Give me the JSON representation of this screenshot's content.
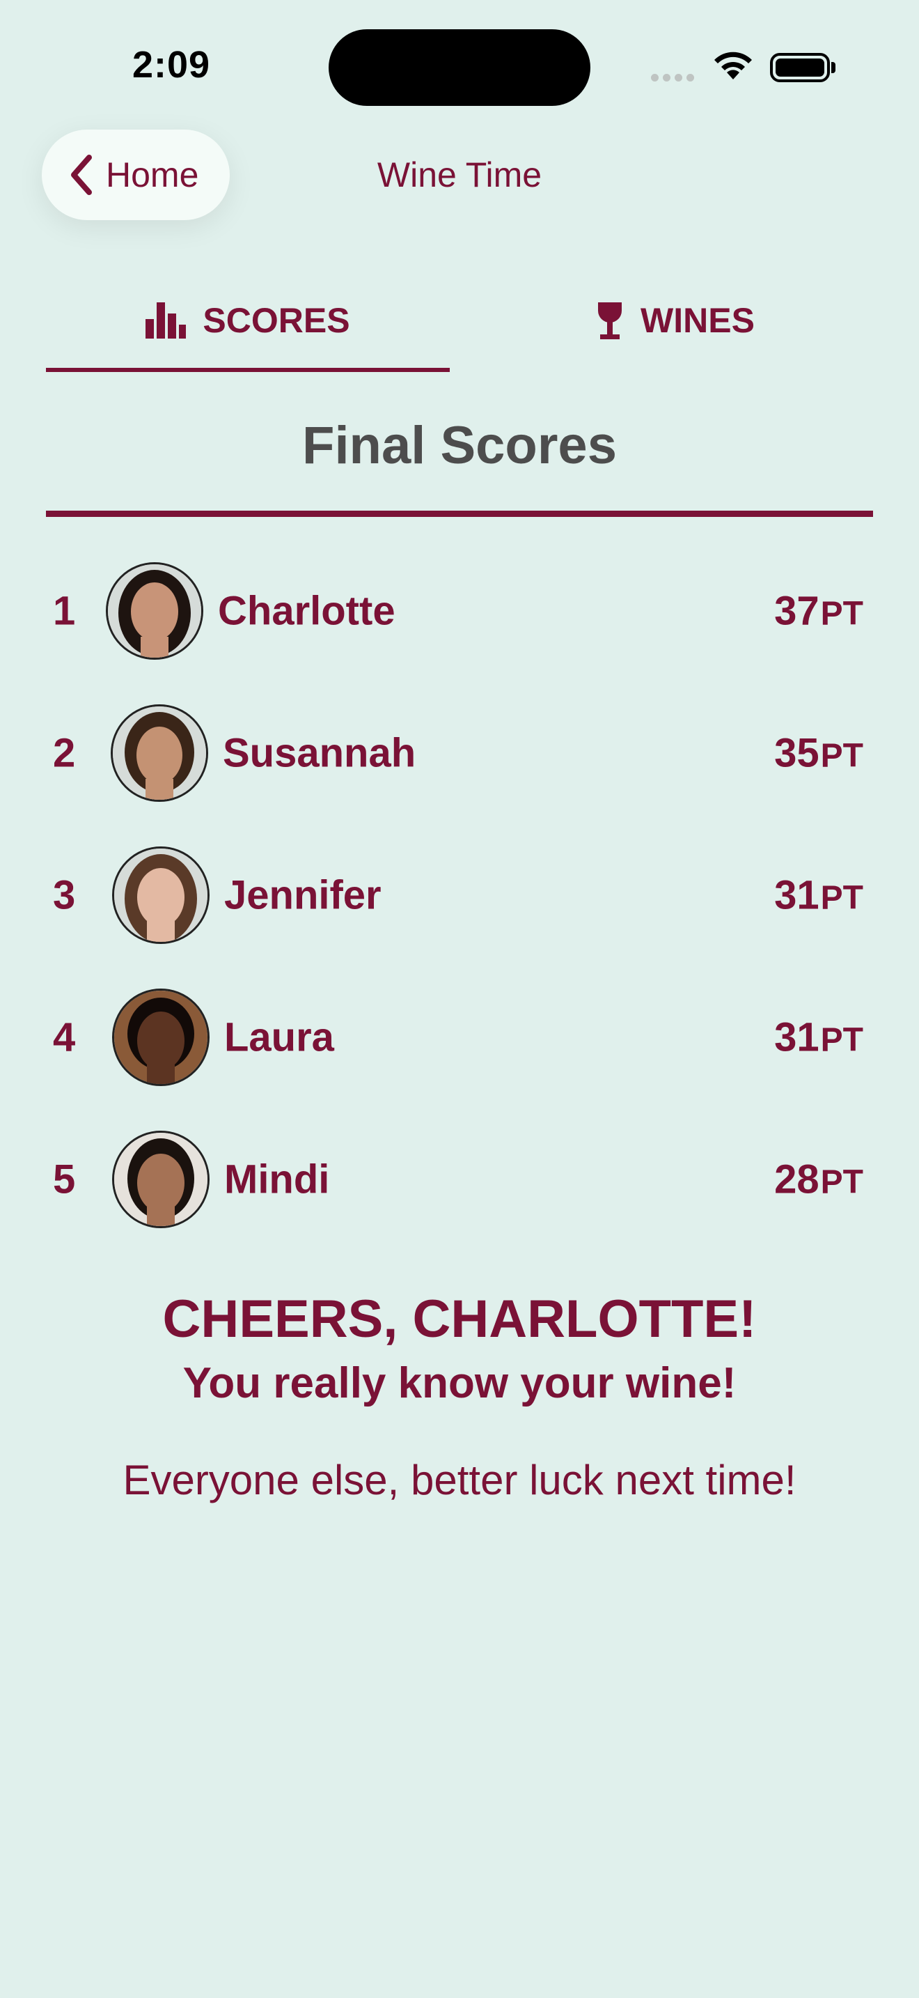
{
  "status_bar": {
    "time": "2:09"
  },
  "nav": {
    "back_label": "Home",
    "title": "Wine Time"
  },
  "tabs": [
    {
      "label": "SCORES",
      "icon": "bar-chart-icon",
      "selected": true
    },
    {
      "label": "WINES",
      "icon": "wine-glass-icon",
      "selected": false
    }
  ],
  "section_title": "Final Scores",
  "scores": [
    {
      "rank": "1",
      "name": "Charlotte",
      "points": "37",
      "unit": "PT",
      "avatar_skin": "#c89478",
      "avatar_hair": "#1e1410"
    },
    {
      "rank": "2",
      "name": "Susannah",
      "points": "35",
      "unit": "PT",
      "avatar_skin": "#c49273",
      "avatar_hair": "#3a2518"
    },
    {
      "rank": "3",
      "name": "Jennifer",
      "points": "31",
      "unit": "PT",
      "avatar_skin": "#e3b9a3",
      "avatar_hair": "#5a3a28"
    },
    {
      "rank": "4",
      "name": "Laura",
      "points": "31",
      "unit": "PT",
      "avatar_skin": "#5c3422",
      "avatar_hair": "#120a08"
    },
    {
      "rank": "5",
      "name": "Mindi",
      "points": "28",
      "unit": "PT",
      "avatar_skin": "#a57255",
      "avatar_hair": "#1a120e"
    }
  ],
  "message": {
    "cheers": "CHEERS, CHARLOTTE!",
    "subtitle": "You really know your wine!",
    "others": "Everyone else, better luck next time!"
  },
  "colors": {
    "accent": "#7a1236",
    "background": "#e0f0ec",
    "title_gray": "#4d4d4d"
  }
}
